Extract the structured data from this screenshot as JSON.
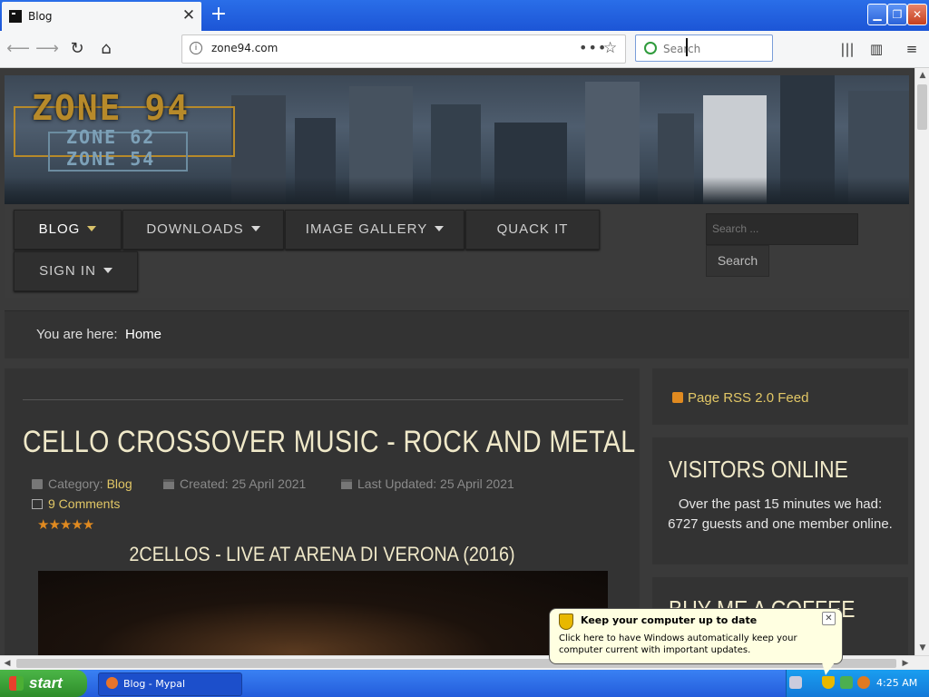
{
  "browser": {
    "tab_title": "Blog",
    "tab_close": "✕",
    "new_tab": "+",
    "url": "zone94.com",
    "search_placeholder": "Search",
    "window_buttons": {
      "minimize": "▁",
      "maximize": "❐",
      "close": "✕"
    }
  },
  "site": {
    "logo_main": "ZONE 94",
    "logo_sub1": "ZONE 62",
    "logo_sub2": "ZONE 54",
    "menu": [
      {
        "label": "BLOG",
        "dropdown": true
      },
      {
        "label": "DOWNLOADS",
        "dropdown": true
      },
      {
        "label": "IMAGE GALLERY",
        "dropdown": true
      },
      {
        "label": "QUACK IT",
        "dropdown": false
      },
      {
        "label": "SIGN IN",
        "dropdown": true
      }
    ],
    "search_placeholder": "Search ...",
    "search_button": "Search",
    "accent_color": "#e2c766"
  },
  "breadcrumb": {
    "label": "You are here:",
    "current": "Home"
  },
  "article": {
    "title": "CELLO CROSSOVER MUSIC - ROCK AND METAL",
    "category_label": "Category:",
    "category": "Blog",
    "created": "Created: 25 April 2021",
    "updated": "Last Updated: 25 April 2021",
    "comments": "9 Comments",
    "rating": "★★★★★",
    "video_title": "2CELLOS - LIVE AT ARENA DI VERONA (2016)"
  },
  "sidebar": {
    "rss": "Page RSS 2.0 Feed",
    "visitors_title": "VISITORS ONLINE",
    "visitors_text": "Over the past 15 minutes we had: 6727 guests and one member online.",
    "coffee_title": "BUY ME A COFFEE"
  },
  "notification": {
    "title": "Keep your computer up to date",
    "body": "Click here to have Windows automatically keep your computer current with important updates.",
    "close": "✕"
  },
  "taskbar": {
    "start": "start",
    "task_item": "Blog - Mypal",
    "clock": "4:25 AM"
  }
}
